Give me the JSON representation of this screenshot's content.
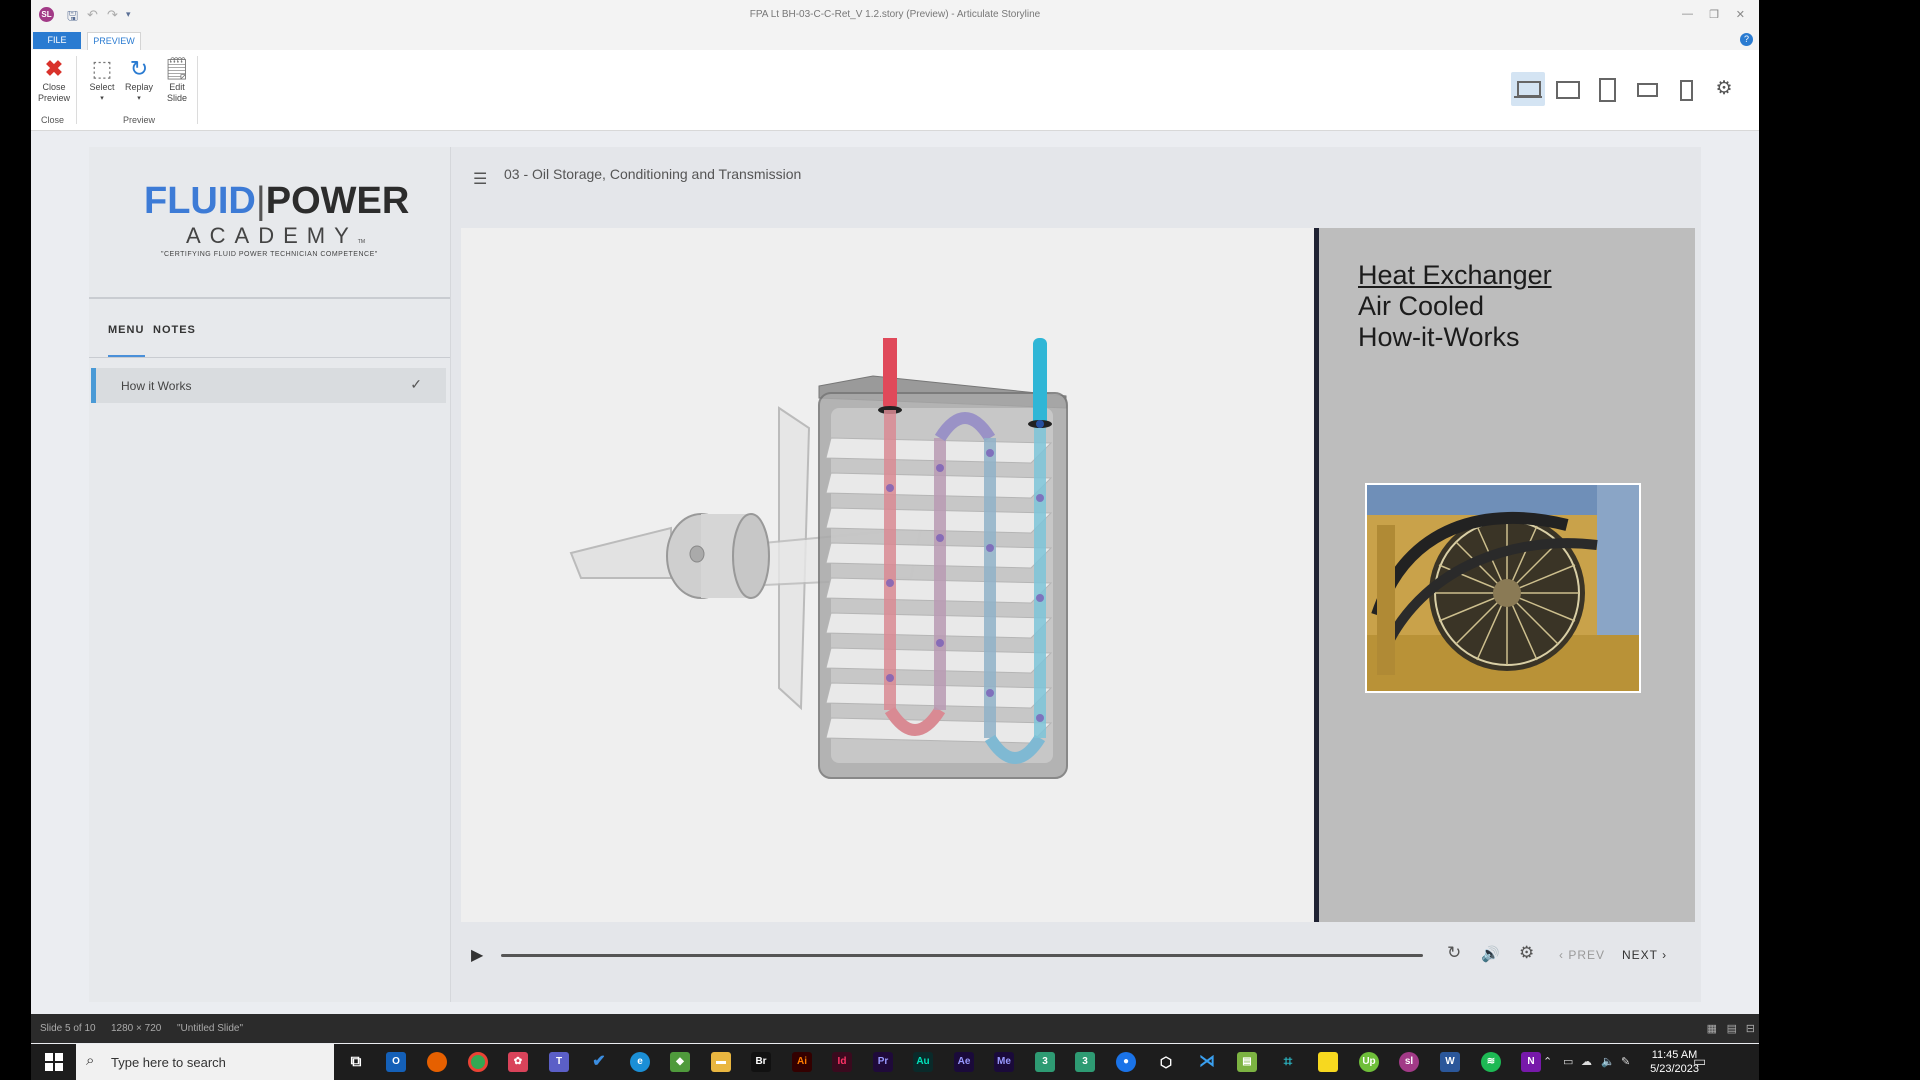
{
  "window": {
    "title": "FPA Lt BH-03-C-C-Ret_V 1.2.story (Preview) - Articulate Storyline",
    "app_icon_label": "SL"
  },
  "ribbon": {
    "tabs": [
      "FILE",
      "PREVIEW"
    ],
    "help": "?",
    "buttons": [
      {
        "label": "Close Preview",
        "icon": "close-preview-icon"
      },
      {
        "label": "Select",
        "icon": "select-icon"
      },
      {
        "label": "Replay",
        "icon": "replay-icon"
      },
      {
        "label": "Edit Slide",
        "icon": "edit-slide-icon"
      }
    ],
    "groups": [
      "Close",
      "Preview"
    ]
  },
  "player": {
    "brand": {
      "fluid": "FLUID",
      "power": "POWER",
      "academy": "ACADEMY",
      "tm": "TM",
      "tagline": "\"CERTIFYING FLUID POWER TECHNICIAN COMPETENCE\""
    },
    "sidebar_tabs": [
      "MENU",
      "NOTES"
    ],
    "menu_items": [
      {
        "label": "How it Works",
        "visited": true
      }
    ],
    "course_title": "03 - Oil Storage, Conditioning and Transmission",
    "slide": {
      "heading": "Heat Exchanger",
      "line2": "Air Cooled",
      "line3": "How-it-Works"
    },
    "controls": {
      "prev": "PREV",
      "next": "NEXT"
    }
  },
  "status_bar": {
    "slide": "Slide 5 of 10",
    "size": "1280 × 720",
    "slide_name": "\"Untitled Slide\""
  },
  "taskbar": {
    "search_placeholder": "Type here to search",
    "time": "11:45 AM",
    "date": "5/23/2023"
  },
  "colors": {
    "accent": "#2a7bd1",
    "brand_blue": "#3d7bd6",
    "menu_accent": "#4a9ad6",
    "hot_pipe": "#e0495a",
    "cold_pipe": "#2fb6d6"
  }
}
